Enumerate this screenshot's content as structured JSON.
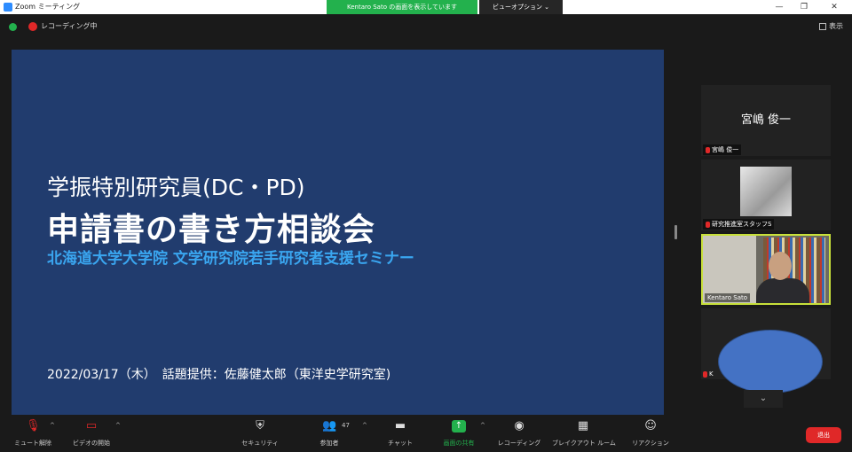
{
  "window": {
    "app_title": "Zoom ミーティング",
    "share_banner": "Kentaro Sato の画面を表示しています",
    "view_options": "ビューオプション ⌄",
    "controls": [
      "—",
      "❐",
      "✕"
    ]
  },
  "status": {
    "recording_label": "レコーディング中",
    "view_label": "表示"
  },
  "slide": {
    "title_line1": "学振特別研究員(DC・PD)",
    "title_line2": "申請書の書き方相談会",
    "subtitle": "北海道大学大学院 文学研究院若手研究者支援セミナー",
    "footer": "2022/03/17（木）　話題提供：佐藤健太郎（東洋史学研究室)"
  },
  "participants": [
    {
      "display_name": "宮嶋 俊一",
      "label": "宮嶋 俊一"
    },
    {
      "label": "研究推進室スタッフS"
    },
    {
      "label": "Kentaro Sato"
    },
    {
      "label": "K"
    }
  ],
  "toolbar": {
    "mute": "ミュート解除",
    "video": "ビデオの開始",
    "security": "セキュリティ",
    "participants": "参加者",
    "participants_count": "47",
    "chat": "チャット",
    "share": "画面の共有",
    "record": "レコーディング",
    "layout": "ブレイクアウト ルーム",
    "reactions": "リアクション",
    "leave": "退出"
  },
  "colors": {
    "slide_bg": "#213c6e",
    "subtitle": "#3aa6f0",
    "share_green": "#23b14d",
    "leave_red": "#e02828",
    "active_speaker_border": "#c8e03a"
  }
}
